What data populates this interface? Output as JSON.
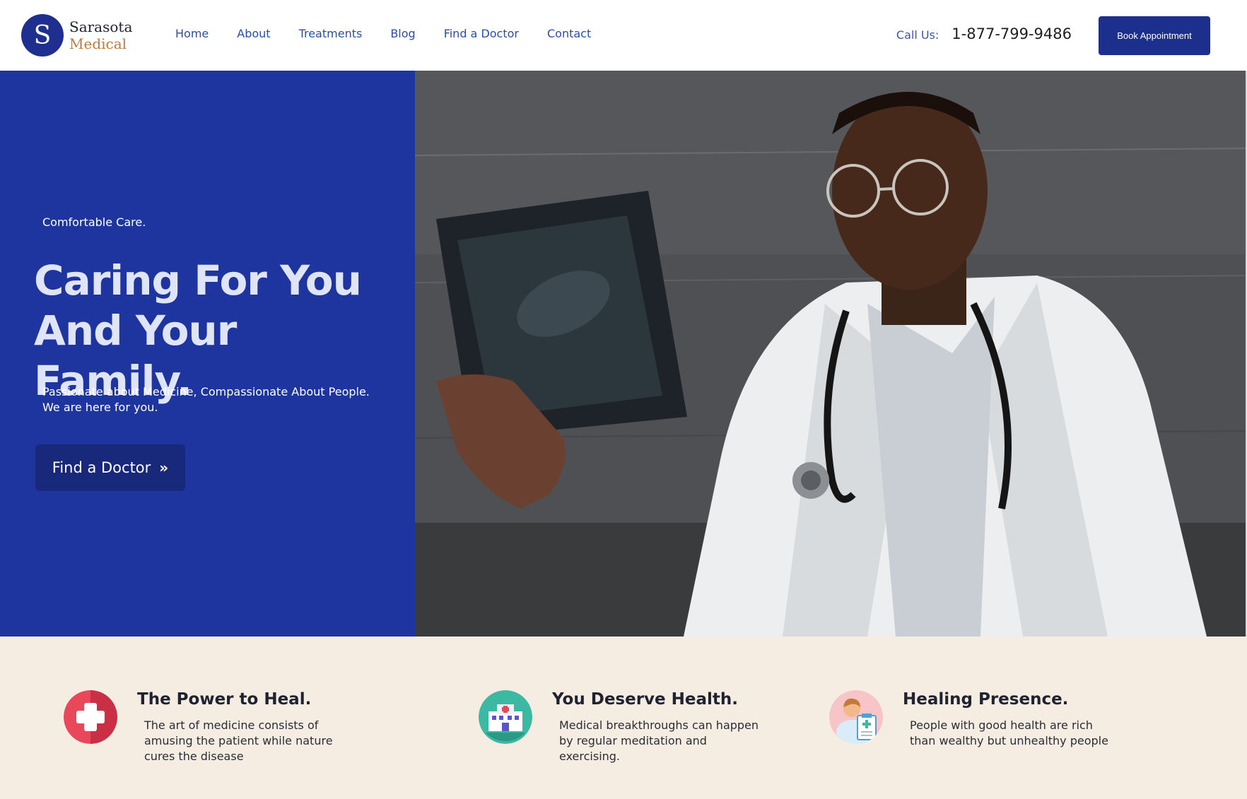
{
  "brand": {
    "badge_letter": "S",
    "name_line1": "Sarasota",
    "name_line2": "Medical",
    "primary_color": "#1e349f",
    "accent_color": "#c07a3a"
  },
  "nav": {
    "items": [
      {
        "label": "Home"
      },
      {
        "label": "About"
      },
      {
        "label": "Treatments"
      },
      {
        "label": "Blog"
      },
      {
        "label": "Find a Doctor"
      },
      {
        "label": "Contact"
      }
    ]
  },
  "contact": {
    "label": "Call Us:",
    "phone": "1-877-799-9486"
  },
  "header": {
    "cta_label": "Book Appointment"
  },
  "hero": {
    "eyebrow": "Comfortable Care.",
    "title_line1": "Caring For You",
    "title_line2": "And Your Family.",
    "subtitle": "Passionate about Medicine, Compassionate About People. We are here for you.",
    "button_label": "Find a Doctor",
    "button_icon": "double-chevron-right-icon",
    "photo": "doctor-holding-xray"
  },
  "features": [
    {
      "icon": "medical-cross-icon",
      "title": "The Power to Heal.",
      "text": "The art of medicine consists of amusing the patient while nature cures the disease"
    },
    {
      "icon": "hospital-icon",
      "title": "You Deserve Health.",
      "text": "Medical breakthroughs can happen by regular meditation and exercising."
    },
    {
      "icon": "doctor-clipboard-icon",
      "title": "Healing Presence.",
      "text": "People with good health are rich than wealthy but unhealthy people"
    }
  ]
}
